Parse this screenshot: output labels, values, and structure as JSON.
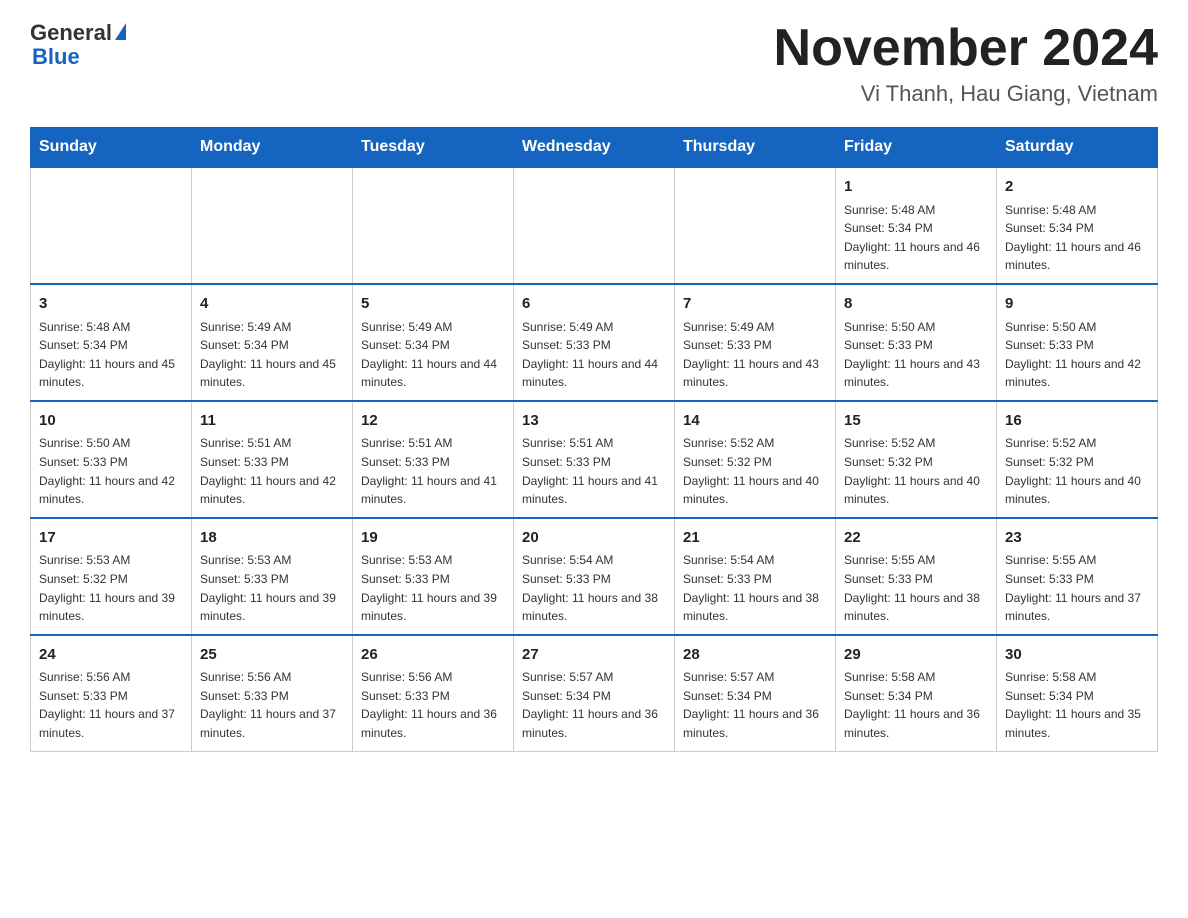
{
  "logo": {
    "text_general": "General",
    "text_blue": "Blue"
  },
  "header": {
    "title": "November 2024",
    "subtitle": "Vi Thanh, Hau Giang, Vietnam"
  },
  "weekdays": [
    "Sunday",
    "Monday",
    "Tuesday",
    "Wednesday",
    "Thursday",
    "Friday",
    "Saturday"
  ],
  "weeks": [
    [
      {
        "day": "",
        "info": ""
      },
      {
        "day": "",
        "info": ""
      },
      {
        "day": "",
        "info": ""
      },
      {
        "day": "",
        "info": ""
      },
      {
        "day": "",
        "info": ""
      },
      {
        "day": "1",
        "info": "Sunrise: 5:48 AM\nSunset: 5:34 PM\nDaylight: 11 hours and 46 minutes."
      },
      {
        "day": "2",
        "info": "Sunrise: 5:48 AM\nSunset: 5:34 PM\nDaylight: 11 hours and 46 minutes."
      }
    ],
    [
      {
        "day": "3",
        "info": "Sunrise: 5:48 AM\nSunset: 5:34 PM\nDaylight: 11 hours and 45 minutes."
      },
      {
        "day": "4",
        "info": "Sunrise: 5:49 AM\nSunset: 5:34 PM\nDaylight: 11 hours and 45 minutes."
      },
      {
        "day": "5",
        "info": "Sunrise: 5:49 AM\nSunset: 5:34 PM\nDaylight: 11 hours and 44 minutes."
      },
      {
        "day": "6",
        "info": "Sunrise: 5:49 AM\nSunset: 5:33 PM\nDaylight: 11 hours and 44 minutes."
      },
      {
        "day": "7",
        "info": "Sunrise: 5:49 AM\nSunset: 5:33 PM\nDaylight: 11 hours and 43 minutes."
      },
      {
        "day": "8",
        "info": "Sunrise: 5:50 AM\nSunset: 5:33 PM\nDaylight: 11 hours and 43 minutes."
      },
      {
        "day": "9",
        "info": "Sunrise: 5:50 AM\nSunset: 5:33 PM\nDaylight: 11 hours and 42 minutes."
      }
    ],
    [
      {
        "day": "10",
        "info": "Sunrise: 5:50 AM\nSunset: 5:33 PM\nDaylight: 11 hours and 42 minutes."
      },
      {
        "day": "11",
        "info": "Sunrise: 5:51 AM\nSunset: 5:33 PM\nDaylight: 11 hours and 42 minutes."
      },
      {
        "day": "12",
        "info": "Sunrise: 5:51 AM\nSunset: 5:33 PM\nDaylight: 11 hours and 41 minutes."
      },
      {
        "day": "13",
        "info": "Sunrise: 5:51 AM\nSunset: 5:33 PM\nDaylight: 11 hours and 41 minutes."
      },
      {
        "day": "14",
        "info": "Sunrise: 5:52 AM\nSunset: 5:32 PM\nDaylight: 11 hours and 40 minutes."
      },
      {
        "day": "15",
        "info": "Sunrise: 5:52 AM\nSunset: 5:32 PM\nDaylight: 11 hours and 40 minutes."
      },
      {
        "day": "16",
        "info": "Sunrise: 5:52 AM\nSunset: 5:32 PM\nDaylight: 11 hours and 40 minutes."
      }
    ],
    [
      {
        "day": "17",
        "info": "Sunrise: 5:53 AM\nSunset: 5:32 PM\nDaylight: 11 hours and 39 minutes."
      },
      {
        "day": "18",
        "info": "Sunrise: 5:53 AM\nSunset: 5:33 PM\nDaylight: 11 hours and 39 minutes."
      },
      {
        "day": "19",
        "info": "Sunrise: 5:53 AM\nSunset: 5:33 PM\nDaylight: 11 hours and 39 minutes."
      },
      {
        "day": "20",
        "info": "Sunrise: 5:54 AM\nSunset: 5:33 PM\nDaylight: 11 hours and 38 minutes."
      },
      {
        "day": "21",
        "info": "Sunrise: 5:54 AM\nSunset: 5:33 PM\nDaylight: 11 hours and 38 minutes."
      },
      {
        "day": "22",
        "info": "Sunrise: 5:55 AM\nSunset: 5:33 PM\nDaylight: 11 hours and 38 minutes."
      },
      {
        "day": "23",
        "info": "Sunrise: 5:55 AM\nSunset: 5:33 PM\nDaylight: 11 hours and 37 minutes."
      }
    ],
    [
      {
        "day": "24",
        "info": "Sunrise: 5:56 AM\nSunset: 5:33 PM\nDaylight: 11 hours and 37 minutes."
      },
      {
        "day": "25",
        "info": "Sunrise: 5:56 AM\nSunset: 5:33 PM\nDaylight: 11 hours and 37 minutes."
      },
      {
        "day": "26",
        "info": "Sunrise: 5:56 AM\nSunset: 5:33 PM\nDaylight: 11 hours and 36 minutes."
      },
      {
        "day": "27",
        "info": "Sunrise: 5:57 AM\nSunset: 5:34 PM\nDaylight: 11 hours and 36 minutes."
      },
      {
        "day": "28",
        "info": "Sunrise: 5:57 AM\nSunset: 5:34 PM\nDaylight: 11 hours and 36 minutes."
      },
      {
        "day": "29",
        "info": "Sunrise: 5:58 AM\nSunset: 5:34 PM\nDaylight: 11 hours and 36 minutes."
      },
      {
        "day": "30",
        "info": "Sunrise: 5:58 AM\nSunset: 5:34 PM\nDaylight: 11 hours and 35 minutes."
      }
    ]
  ]
}
